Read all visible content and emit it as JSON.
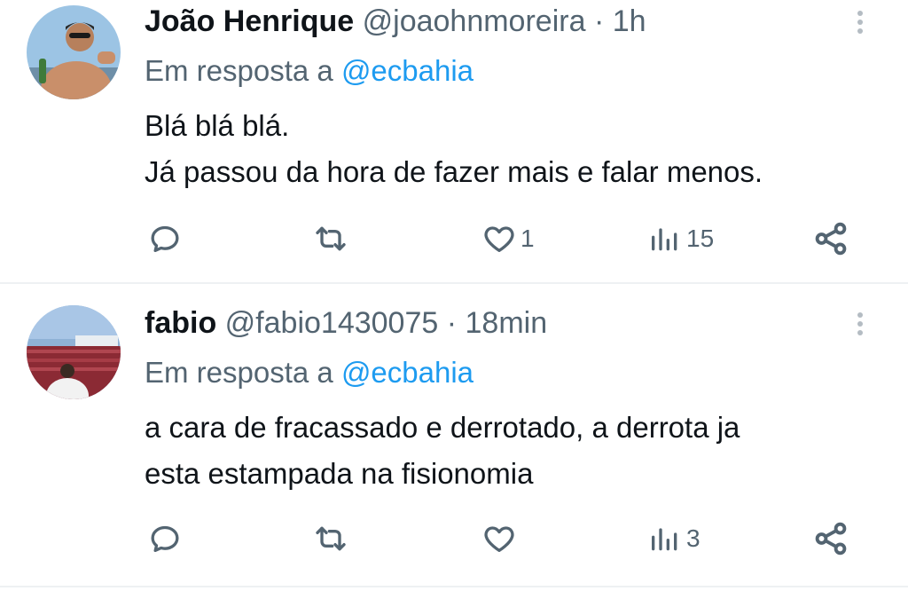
{
  "tweets": [
    {
      "display_name": "João Henrique",
      "handle": "@joaohnmoreira",
      "separator": "·",
      "time": "1h",
      "reply_prefix": "Em resposta a",
      "reply_to": "@ecbahia",
      "text_lines": [
        "Blá blá blá.",
        "Já passou da hora de fazer mais e falar menos."
      ],
      "likes": "1",
      "views": "15"
    },
    {
      "display_name": "fabio",
      "handle": "@fabio1430075",
      "separator": "·",
      "time": "18min",
      "reply_prefix": "Em resposta a",
      "reply_to": "@ecbahia",
      "text_lines": [
        "a cara de fracassado e derrotado, a derrota ja",
        "esta estampada na fisionomia"
      ],
      "likes": "",
      "views": "3"
    }
  ],
  "icons": {
    "reply": "reply-icon",
    "retweet": "retweet-icon",
    "like": "heart-icon",
    "views": "views-icon",
    "share": "share-icon",
    "more": "more-icon"
  },
  "colors": {
    "text": "#0f1419",
    "secondary": "#536471",
    "mention": "#1d9bf0",
    "divider": "#eef1f3"
  }
}
